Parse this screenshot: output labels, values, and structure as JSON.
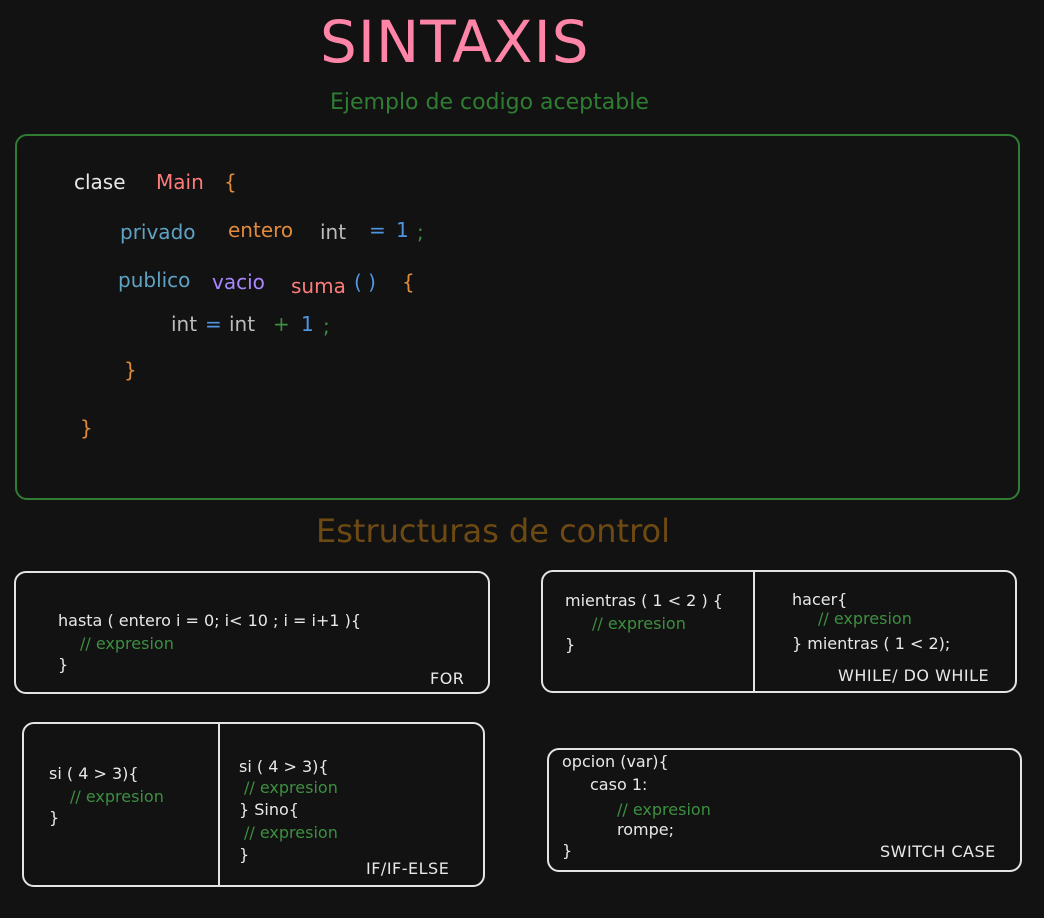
{
  "title": "SINTAXIS",
  "subtitle": "Ejemplo de codigo aceptable",
  "example": {
    "l1_kw": "clase",
    "l1_name": "Main",
    "l1_brace": "{",
    "l2_kw": "privado",
    "l2_type": "entero",
    "l2_var": "int",
    "l2_eq": "=",
    "l2_num": "1",
    "l2_semi": ";",
    "l3_kw": "publico",
    "l3_type": "vacio",
    "l3_name": "suma",
    "l3_paren": "( )",
    "l3_brace": "{",
    "l4_var": "int",
    "l4_eq": "=",
    "l4_var2": "int",
    "l4_plus": "+",
    "l4_num": "1",
    "l4_semi": ";",
    "l5_brace": "}",
    "l6_brace": "}"
  },
  "section_title": "Estructuras de control",
  "for_box": {
    "line1": "hasta ( entero i = 0; i< 10 ; i = i+1 ){",
    "line2": "// expresion",
    "line3": "}",
    "label": "FOR"
  },
  "while_box": {
    "left_line1": "mientras ( 1 < 2 ) {",
    "left_line2": "// expresion",
    "left_line3": "}",
    "right_line1": "hacer{",
    "right_line2": "// expresion",
    "right_line3": "} mientras ( 1 < 2);",
    "label": "WHILE/ DO WHILE"
  },
  "if_box": {
    "left_line1": "si ( 4 > 3){",
    "left_line2": "// expresion",
    "left_line3": "}",
    "right_line1": "si ( 4 > 3){",
    "right_line2": "// expresion",
    "right_line3": "} Sino{",
    "right_line4": "// expresion",
    "right_line5": "}",
    "label": "IF/IF-ELSE"
  },
  "switch_box": {
    "line1": "opcion (var){",
    "line2": "caso 1:",
    "line3": "// expresion",
    "line4": "rompe;",
    "line5": "}",
    "label": "SWITCH CASE"
  },
  "colors": {
    "title": "#ff85a8",
    "subtitle": "#2f7d32",
    "section": "#6e4a12",
    "comment": "#3d8f40",
    "background": "#121212"
  }
}
